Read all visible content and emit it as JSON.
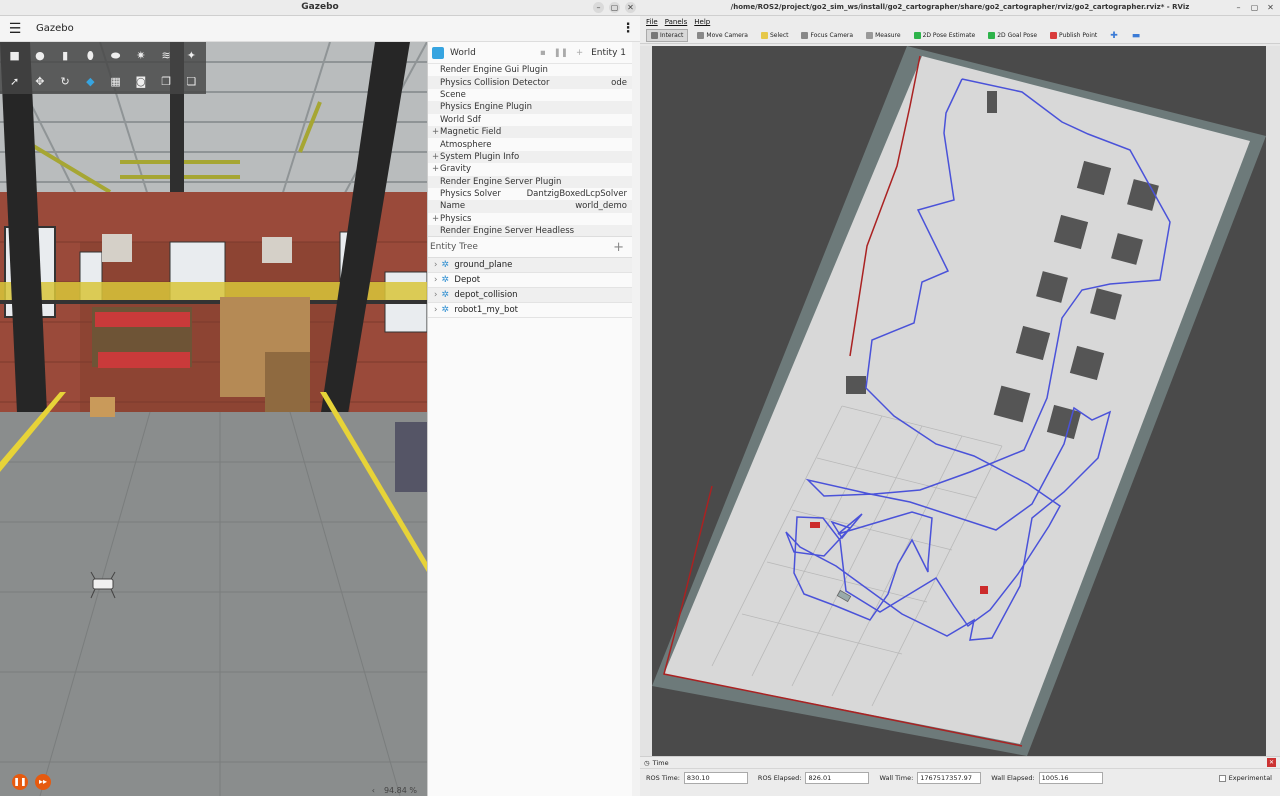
{
  "gazebo": {
    "window_title": "Gazebo",
    "app_title": "Gazebo",
    "world_label": "World",
    "entity_label": "Entity 1",
    "properties": [
      {
        "name": "Render Engine Gui Plugin",
        "value": "",
        "expandable": false
      },
      {
        "name": "Physics Collision Detector",
        "value": "ode",
        "expandable": false
      },
      {
        "name": "Scene",
        "value": "",
        "expandable": false
      },
      {
        "name": "Physics Engine Plugin",
        "value": "",
        "expandable": false
      },
      {
        "name": "World Sdf",
        "value": "",
        "expandable": false
      },
      {
        "name": "Magnetic Field",
        "value": "",
        "expandable": true
      },
      {
        "name": "Atmosphere",
        "value": "",
        "expandable": false
      },
      {
        "name": "System Plugin Info",
        "value": "",
        "expandable": true
      },
      {
        "name": "Gravity",
        "value": "",
        "expandable": true
      },
      {
        "name": "Render Engine Server Plugin",
        "value": "",
        "expandable": false
      },
      {
        "name": "Physics Solver",
        "value": "DantzigBoxedLcpSolver",
        "expandable": false
      },
      {
        "name": "Name",
        "value": "world_demo",
        "expandable": false
      },
      {
        "name": "Physics",
        "value": "",
        "expandable": true
      },
      {
        "name": "Render Engine Server Headless",
        "value": "",
        "expandable": false
      }
    ],
    "entity_tree_label": "Entity Tree",
    "entities": [
      "ground_plane",
      "Depot",
      "depot_collision",
      "robot1_my_bot"
    ],
    "rtf": "94.84 %",
    "colors": {
      "accent": "#e65a0f",
      "icon": "#36a4e0"
    }
  },
  "rviz": {
    "window_title": "/home/ROS2/project/go2_sim_ws/install/go2_cartographer/share/go2_cartographer/rviz/go2_cartographer.rviz* - RViz",
    "menu": [
      "File",
      "Panels",
      "Help"
    ],
    "tools": [
      {
        "label": "Interact",
        "icon": "hand-icon",
        "color": "#777777",
        "active": true
      },
      {
        "label": "Move Camera",
        "icon": "move-camera-icon",
        "color": "#888888",
        "active": false
      },
      {
        "label": "Select",
        "icon": "select-icon",
        "color": "#e6c84a",
        "active": false
      },
      {
        "label": "Focus Camera",
        "icon": "focus-camera-icon",
        "color": "#888888",
        "active": false
      },
      {
        "label": "Measure",
        "icon": "measure-icon",
        "color": "#999999",
        "active": false
      },
      {
        "label": "2D Pose Estimate",
        "icon": "pose-estimate-icon",
        "color": "#2db34a",
        "active": false
      },
      {
        "label": "2D Goal Pose",
        "icon": "goal-pose-icon",
        "color": "#2db34a",
        "active": false
      },
      {
        "label": "Publish Point",
        "icon": "publish-point-icon",
        "color": "#d93b3b",
        "active": false
      }
    ],
    "time_panel": {
      "title": "Time",
      "ros_time_label": "ROS Time:",
      "ros_time": "830.10",
      "ros_elapsed_label": "ROS Elapsed:",
      "ros_elapsed": "826.01",
      "wall_time_label": "Wall Time:",
      "wall_time": "1767517357.97",
      "wall_elapsed_label": "Wall Elapsed:",
      "wall_elapsed": "1005.16",
      "experimental_label": "Experimental"
    },
    "colors": {
      "path": "#4a52d9",
      "map_free": "#d8d8d8",
      "map_unknown": "#6d7a7a"
    }
  }
}
